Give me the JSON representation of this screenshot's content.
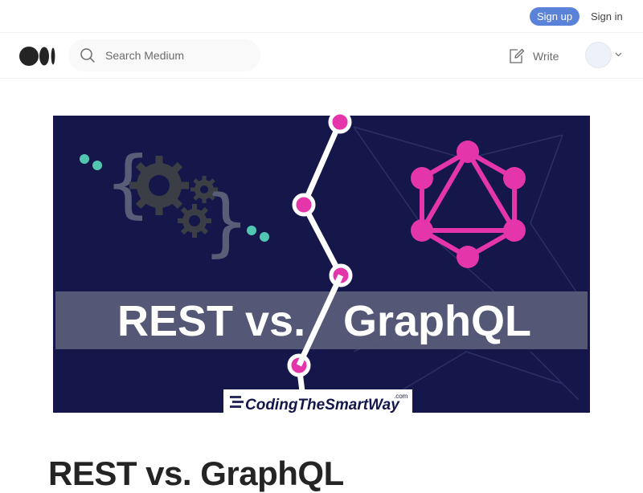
{
  "topbar": {
    "signup_label": "Sign up",
    "signin_label": "Sign in"
  },
  "header": {
    "logo_icon": "medium-logo-icon",
    "search": {
      "icon": "search-icon",
      "placeholder": "Search Medium",
      "value": ""
    },
    "write_label": "Write",
    "write_icon": "write-icon",
    "avatar_icon": "avatar",
    "chevron_icon": "chevron-down-icon"
  },
  "hero_image": {
    "left_text": "REST vs.",
    "right_text": "GraphQL",
    "brand_text": "CodingTheSmartWay",
    "brand_suffix": ".com",
    "colors": {
      "background": "#15174a",
      "accent": "#e535ab",
      "band": "#5a5d78",
      "gear": "#3b3e44",
      "dots": "#52c7b0"
    }
  },
  "article": {
    "title": "REST vs. GraphQL"
  }
}
